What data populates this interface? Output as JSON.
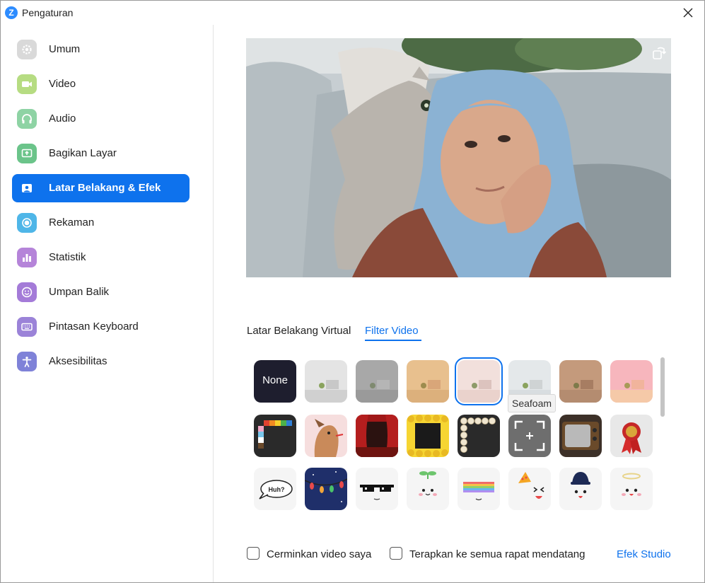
{
  "window": {
    "title": "Pengaturan"
  },
  "sidebar": {
    "items": [
      {
        "label": "Umum",
        "icon": "gear-icon",
        "color": "#D9D9D9"
      },
      {
        "label": "Video",
        "icon": "video-camera-icon",
        "color": "#B6DC82"
      },
      {
        "label": "Audio",
        "icon": "headphones-icon",
        "color": "#8ED3A4"
      },
      {
        "label": "Bagikan Layar",
        "icon": "share-screen-icon",
        "color": "#6BC48A"
      },
      {
        "label": "Latar Belakang & Efek",
        "icon": "background-icon",
        "color": "#0E72ED",
        "active": true
      },
      {
        "label": "Rekaman",
        "icon": "record-icon",
        "color": "#4FB6E8"
      },
      {
        "label": "Statistik",
        "icon": "statistics-icon",
        "color": "#B584D9"
      },
      {
        "label": "Umpan Balik",
        "icon": "feedback-smiley-icon",
        "color": "#A47BD8"
      },
      {
        "label": "Pintasan Keyboard",
        "icon": "keyboard-icon",
        "color": "#9B83D8"
      },
      {
        "label": "Aksesibilitas",
        "icon": "accessibility-icon",
        "color": "#7F82D8"
      }
    ]
  },
  "tabs": {
    "virtual": "Latar Belakang Virtual",
    "filter": "Filter Video",
    "active": "filter"
  },
  "filters": {
    "none_label": "None",
    "tooltip": "Seafoam",
    "selected_index": 4,
    "rows": [
      [
        "none",
        "light-gray-room",
        "gray-room",
        "beige-room",
        "blush-room",
        "seafoam-room",
        "brown-room",
        "pink-room"
      ],
      [
        "rainbow-frame",
        "dog-sticker",
        "theater-curtain",
        "emoji-frame",
        "pearl-frame",
        "camera-focus-frame",
        "retro-tv-frame",
        "award-ribbon"
      ],
      [
        "huh-speech-bubble",
        "string-lights",
        "pixel-sunglasses",
        "sprout-face",
        "rainbow-halo",
        "party-hat-face",
        "zoom-cap-face",
        "angel-halo-face"
      ]
    ]
  },
  "footer": {
    "mirror_label": "Cerminkan video saya",
    "apply_all_label": "Terapkan ke semua rapat mendatang",
    "studio_link": "Efek Studio",
    "mirror_checked": false,
    "apply_all_checked": false
  },
  "colors": {
    "accent": "#0E72ED"
  }
}
